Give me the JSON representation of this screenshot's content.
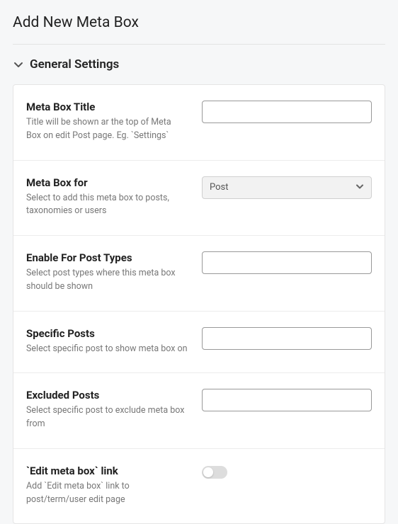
{
  "pageTitle": "Add New Meta Box",
  "section": {
    "title": "General Settings"
  },
  "fields": {
    "title": {
      "label": "Meta Box Title",
      "desc": "Title will be shown ar the top of Meta Box on edit Post page. Eg. `Settings`",
      "value": ""
    },
    "for": {
      "label": "Meta Box for",
      "desc": "Select to add this meta box to posts, taxonomies or users",
      "selected": "Post"
    },
    "postTypes": {
      "label": "Enable For Post Types",
      "desc": "Select post types where this meta box should be shown",
      "value": ""
    },
    "specificPosts": {
      "label": "Specific Posts",
      "desc": "Select specific post to show meta box on",
      "value": ""
    },
    "excludedPosts": {
      "label": "Excluded Posts",
      "desc": "Select specific post to exclude meta box from",
      "value": ""
    },
    "editLink": {
      "label": "`Edit meta box` link",
      "desc": "Add `Edit meta box` link to post/term/user edit page"
    }
  }
}
